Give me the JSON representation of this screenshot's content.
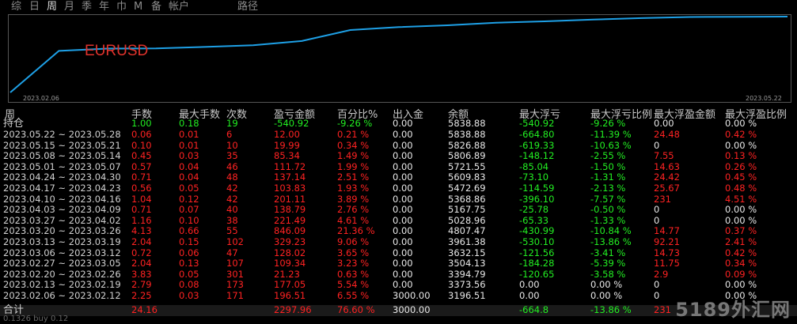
{
  "tabs": [
    "综",
    "日",
    "周",
    "月",
    "季",
    "年",
    "巾",
    "M",
    "备",
    "帐户",
    "路径"
  ],
  "chart": {
    "symbol": "EURUSD",
    "start_date": "2023.02.06",
    "end_date": "2023.05.22",
    "line_color": "#1ea0e6"
  },
  "columns": [
    "周",
    "手数",
    "最大手数",
    "次数",
    "盈亏金额",
    "百分比%",
    "出入金",
    "余额",
    "最大浮亏",
    "最大浮亏比例",
    "最大浮盈金额",
    "最大浮盈比例"
  ],
  "holding": {
    "label": "持仓",
    "cells": [
      "1.00",
      "0.18",
      "19",
      "-540.92",
      "-9.26 %",
      "0.00",
      "5838.88",
      "-540.92",
      "-9.26 %",
      "0.00",
      "0.00 %"
    ]
  },
  "rows": [
    {
      "period": "2023.05.22 ~ 2023.05.28",
      "cells": [
        "0.06",
        "0.01",
        "6",
        "12.00",
        "0.21 %",
        "0.00",
        "5838.88",
        "-664.80",
        "-11.39 %",
        "24.48",
        "0.42 %"
      ]
    },
    {
      "period": "2023.05.15 ~ 2023.05.21",
      "cells": [
        "0.10",
        "0.01",
        "10",
        "19.99",
        "0.34 %",
        "0.00",
        "5826.88",
        "-619.33",
        "-10.63 %",
        "0",
        "0.00 %"
      ]
    },
    {
      "period": "2023.05.08 ~ 2023.05.14",
      "cells": [
        "0.45",
        "0.03",
        "35",
        "85.34",
        "1.49 %",
        "0.00",
        "5806.89",
        "-148.12",
        "-2.55 %",
        "7.55",
        "0.13 %"
      ]
    },
    {
      "period": "2023.05.01 ~ 2023.05.07",
      "cells": [
        "0.57",
        "0.04",
        "46",
        "111.72",
        "1.99 %",
        "0.00",
        "5721.55",
        "-85.04",
        "-1.50 %",
        "14.63",
        "0.26 %"
      ]
    },
    {
      "period": "2023.04.24 ~ 2023.04.30",
      "cells": [
        "0.71",
        "0.04",
        "48",
        "137.14",
        "2.51 %",
        "0.00",
        "5609.83",
        "-73.10",
        "-1.31 %",
        "24.42",
        "0.45 %"
      ]
    },
    {
      "period": "2023.04.17 ~ 2023.04.23",
      "cells": [
        "0.56",
        "0.05",
        "42",
        "103.83",
        "1.93 %",
        "0.00",
        "5472.69",
        "-114.59",
        "-2.13 %",
        "25.67",
        "0.48 %"
      ]
    },
    {
      "period": "2023.04.10 ~ 2023.04.16",
      "cells": [
        "1.04",
        "0.12",
        "42",
        "201.11",
        "3.89 %",
        "0.00",
        "5368.86",
        "-396.10",
        "-7.57 %",
        "231",
        "4.51 %"
      ]
    },
    {
      "period": "2023.04.03 ~ 2023.04.09",
      "cells": [
        "0.71",
        "0.07",
        "40",
        "138.79",
        "2.76 %",
        "0.00",
        "5167.75",
        "-25.78",
        "-0.50 %",
        "0",
        "0.00 %"
      ]
    },
    {
      "period": "2023.03.27 ~ 2023.04.02",
      "cells": [
        "1.16",
        "0.10",
        "38",
        "221.49",
        "4.61 %",
        "0.00",
        "5028.96",
        "-65.33",
        "-1.33 %",
        "0",
        "0.00 %"
      ]
    },
    {
      "period": "2023.03.20 ~ 2023.03.26",
      "cells": [
        "4.13",
        "0.66",
        "55",
        "846.09",
        "21.36 %",
        "0.00",
        "4807.47",
        "-430.99",
        "-10.84 %",
        "14.77",
        "0.37 %"
      ]
    },
    {
      "period": "2023.03.13 ~ 2023.03.19",
      "cells": [
        "2.04",
        "0.15",
        "102",
        "329.23",
        "9.06 %",
        "0.00",
        "3961.38",
        "-530.10",
        "-13.86 %",
        "92.21",
        "2.41 %"
      ]
    },
    {
      "period": "2023.03.06 ~ 2023.03.12",
      "cells": [
        "0.72",
        "0.06",
        "47",
        "128.02",
        "3.65 %",
        "0.00",
        "3632.15",
        "-121.56",
        "-3.41 %",
        "14.73",
        "0.42 %"
      ]
    },
    {
      "period": "2023.02.27 ~ 2023.03.05",
      "cells": [
        "2.04",
        "0.13",
        "107",
        "109.34",
        "3.23 %",
        "0.00",
        "3504.13",
        "-184.28",
        "-5.39 %",
        "11.75",
        "0.34 %"
      ]
    },
    {
      "period": "2023.02.20 ~ 2023.02.26",
      "cells": [
        "3.83",
        "0.05",
        "301",
        "21.23",
        "0.63 %",
        "0.00",
        "3394.79",
        "-120.65",
        "-3.58 %",
        "2.9",
        "0.09 %"
      ]
    },
    {
      "period": "2023.02.13 ~ 2023.02.19",
      "cells": [
        "2.79",
        "0.08",
        "173",
        "177.05",
        "5.54 %",
        "0.00",
        "3373.56",
        "0.00",
        "0.00 %",
        "0",
        "0.00 %"
      ]
    },
    {
      "period": "2023.02.06 ~ 2023.02.12",
      "cells": [
        "2.25",
        "0.03",
        "171",
        "196.51",
        "6.55 %",
        "3000.00",
        "3196.51",
        "0.00",
        "0.00 %",
        "0",
        "0.00 %"
      ]
    }
  ],
  "total": {
    "label": "合计",
    "cells": [
      "24.16",
      "",
      "",
      "2297.96",
      "76.60 %",
      "3000.00",
      "",
      "-664.8",
      "-13.86 %",
      "231",
      ""
    ]
  },
  "status_bar": "0.1326 buy 0.12",
  "watermark": "5189外汇网"
}
